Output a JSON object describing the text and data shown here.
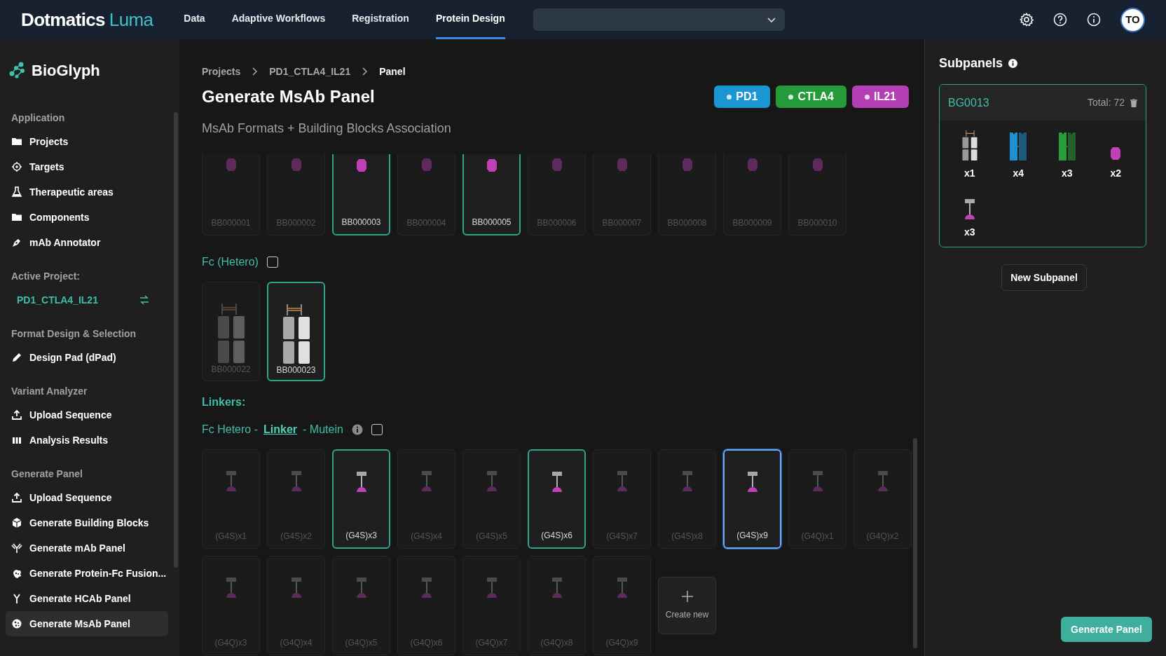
{
  "topbar": {
    "brand": "Dotmatics",
    "brand_accent": "Luma",
    "nav": [
      {
        "label": "Data",
        "selected": false
      },
      {
        "label": "Adaptive Workflows",
        "selected": false
      },
      {
        "label": "Registration",
        "selected": false
      },
      {
        "label": "Protein Design",
        "selected": true
      }
    ],
    "avatar": "TO"
  },
  "sidebar": {
    "app_title": "BioGlyph",
    "sections": [
      {
        "title": "Application",
        "items": [
          {
            "label": "Projects",
            "selected": false
          },
          {
            "label": "Targets",
            "selected": false
          },
          {
            "label": "Therapeutic areas",
            "selected": false
          },
          {
            "label": "Components",
            "selected": false
          },
          {
            "label": "mAb Annotator",
            "selected": false
          }
        ]
      },
      {
        "title": "Active Project:",
        "project": "PD1_CTLA4_IL21"
      },
      {
        "title": "Format Design & Selection",
        "items": [
          {
            "label": "Design Pad (dPad)",
            "selected": false
          }
        ]
      },
      {
        "title": "Variant Analyzer",
        "items": [
          {
            "label": "Upload Sequence",
            "selected": false
          },
          {
            "label": "Analysis Results",
            "selected": false
          }
        ]
      },
      {
        "title": "Generate Panel",
        "items": [
          {
            "label": "Upload Sequence",
            "selected": false
          },
          {
            "label": "Generate Building Blocks",
            "selected": false
          },
          {
            "label": "Generate mAb Panel",
            "selected": false
          },
          {
            "label": "Generate Protein-Fc Fusion...",
            "selected": false
          },
          {
            "label": "Generate HCAb Panel",
            "selected": false
          },
          {
            "label": "Generate MsAb Panel",
            "selected": true
          }
        ]
      }
    ]
  },
  "breadcrumb": [
    "Projects",
    "PD1_CTLA4_IL21",
    "Panel"
  ],
  "title": "Generate MsAb Panel",
  "subtitle": "MsAb Formats + Building Blocks Association",
  "targets": [
    {
      "label": "PD1",
      "color": "#1a96d2"
    },
    {
      "label": "CTLA4",
      "color": "#259a3a"
    },
    {
      "label": "IL21",
      "color": "#b43fb4"
    }
  ],
  "groups": [
    {
      "kind": "mutein",
      "cards": [
        {
          "label": "BB000001",
          "selected": false
        },
        {
          "label": "BB000002",
          "selected": false
        },
        {
          "label": "BB000003",
          "selected": true
        },
        {
          "label": "BB000004",
          "selected": false
        },
        {
          "label": "BB000005",
          "selected": true
        },
        {
          "label": "BB000006",
          "selected": false
        },
        {
          "label": "BB000007",
          "selected": false
        },
        {
          "label": "BB000008",
          "selected": false
        },
        {
          "label": "BB000009",
          "selected": false
        },
        {
          "label": "BB000010",
          "selected": false
        }
      ]
    },
    {
      "kind": "fc_hetero",
      "heading": "Fc (Hetero)",
      "checked": false,
      "cards": [
        {
          "label": "BB000022",
          "selected": false
        },
        {
          "label": "BB000023",
          "selected": true
        }
      ]
    },
    {
      "kind": "linker",
      "section_title": "Linkers:",
      "heading_parts": [
        "Fc Hetero -",
        "Linker",
        "- Mutein"
      ],
      "checked": false,
      "create_label": "Create new",
      "cards": [
        {
          "label": "(G4S)x1",
          "selected": false,
          "focused": false
        },
        {
          "label": "(G4S)x2",
          "selected": false,
          "focused": false
        },
        {
          "label": "(G4S)x3",
          "selected": true,
          "focused": false
        },
        {
          "label": "(G4S)x4",
          "selected": false,
          "focused": false
        },
        {
          "label": "(G4S)x5",
          "selected": false,
          "focused": false
        },
        {
          "label": "(G4S)x6",
          "selected": true,
          "focused": false
        },
        {
          "label": "(G4S)x7",
          "selected": false,
          "focused": false
        },
        {
          "label": "(G4S)x8",
          "selected": false,
          "focused": false
        },
        {
          "label": "(G4S)x9",
          "selected": true,
          "focused": true
        },
        {
          "label": "(G4Q)x1",
          "selected": false,
          "focused": false
        },
        {
          "label": "(G4Q)x2",
          "selected": false,
          "focused": false
        },
        {
          "label": "(G4Q)x3",
          "selected": false,
          "focused": false
        },
        {
          "label": "(G4Q)x4",
          "selected": false,
          "focused": false
        },
        {
          "label": "(G4Q)x5",
          "selected": false,
          "focused": false
        },
        {
          "label": "(G4Q)x6",
          "selected": false,
          "focused": false
        },
        {
          "label": "(G4Q)x7",
          "selected": false,
          "focused": false
        },
        {
          "label": "(G4Q)x8",
          "selected": false,
          "focused": false
        },
        {
          "label": "(G4Q)x9",
          "selected": false,
          "focused": false
        }
      ]
    }
  ],
  "subpanels": {
    "title": "Subpanels",
    "cards": [
      {
        "name": "BG0013",
        "total": "Total: 72",
        "items": [
          {
            "kind": "fc_hetero",
            "count": "x1"
          },
          {
            "kind": "fab",
            "color": "#1e8fd0",
            "count": "x4"
          },
          {
            "kind": "fab",
            "color": "#2a9d3a",
            "count": "x3"
          },
          {
            "kind": "mutein",
            "count": "x2"
          },
          {
            "kind": "linker",
            "count": "x3"
          }
        ]
      }
    ],
    "new_button": "New Subpanel"
  },
  "generate_button": "Generate Panel"
}
